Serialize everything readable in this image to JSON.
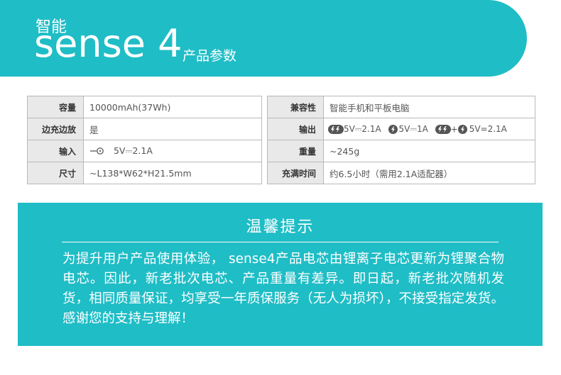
{
  "header": {
    "brand_small": "智能",
    "brand_name": "sense 4",
    "subtitle": "产品参数"
  },
  "specs_left": [
    {
      "label": "容量",
      "value": "10000mAh(37Wh)"
    },
    {
      "label": "边充边放",
      "value": "是"
    },
    {
      "label": "输入",
      "value": "5V⎓2.1A",
      "icon": "plug-icon"
    },
    {
      "label": "尺寸",
      "value": "~L138*W62*H21.5mm"
    }
  ],
  "specs_right": [
    {
      "label": "兼容性",
      "value": "智能手机和平板电脑"
    },
    {
      "label": "输出",
      "outputs": [
        "5V⎓2.1A",
        "5V⎓1A",
        "5V=2.1A"
      ],
      "icons": [
        "double-bolt-icon",
        "bolt-icon",
        "double-bolt-icon",
        "bolt-icon"
      ],
      "plus": "+"
    },
    {
      "label": "重量",
      "value": "~245g"
    },
    {
      "label": "充满时间",
      "value": "约6.5小时（需用2.1A适配器）"
    }
  ],
  "notice": {
    "title": "温馨提示",
    "body": "为提升用户产品使用体验，  sense4产品电芯由锂离子电芯更新为锂聚合物电芯。因此，新老批次电芯、产品重量有差异。即日起，新老批次随机发货，相同质量保证，均享受一年质保服务（无人为损坏），不接受指定发货。感谢您的支持与理解！"
  },
  "colors": {
    "accent": "#1fbdc6",
    "label_bg": "#e9e9e9",
    "border": "#b9b9b9"
  }
}
